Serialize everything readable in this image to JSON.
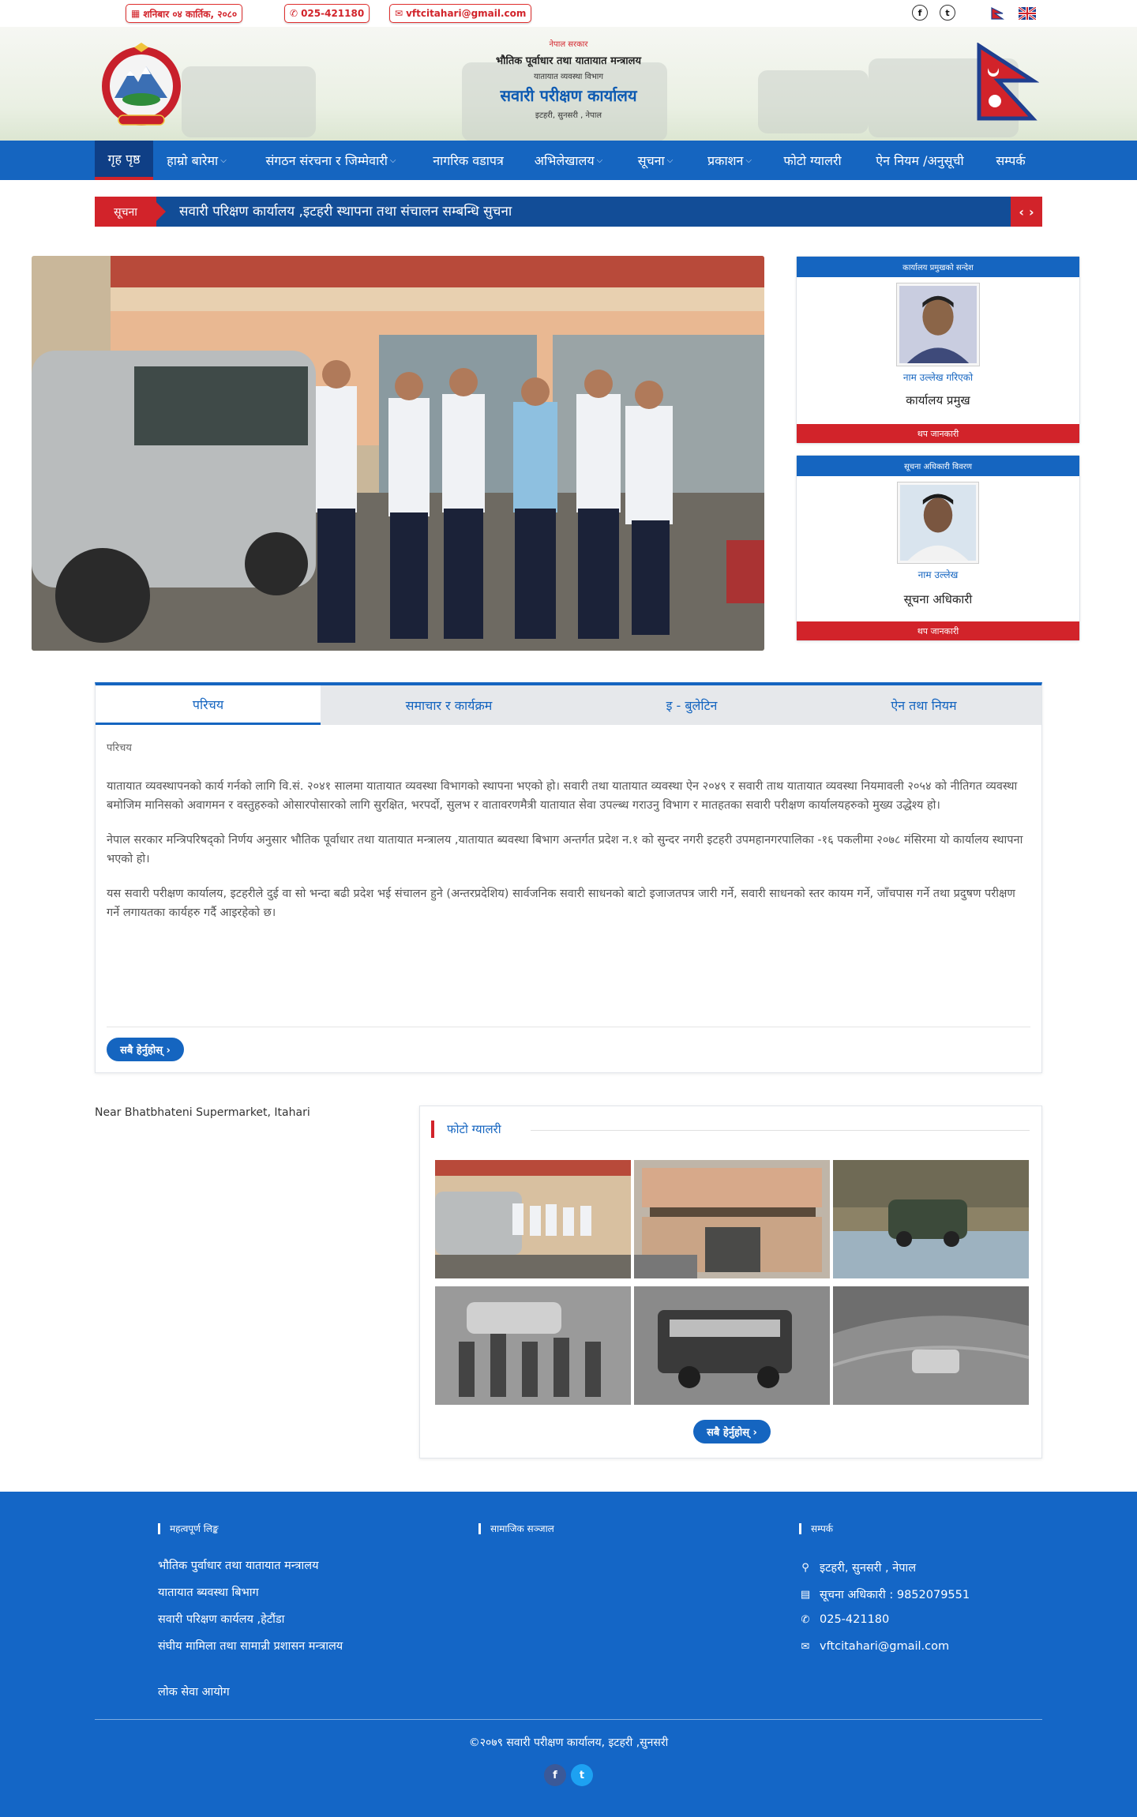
{
  "topbar": {
    "date": "शनिबार ०४ कार्तिक, २०८०",
    "phone": "025-421180",
    "email": "vftcitahari@gmail.com",
    "social": {
      "facebook": "f",
      "twitter": "t"
    }
  },
  "header": {
    "line1": "नेपाल सरकार",
    "line2": "भौतिक पूर्वाधार तथा यातायात मन्त्रालय",
    "line3": "यातायात व्यवस्था विभाग",
    "line4": "सवारी परीक्षण कार्यालय",
    "line5": "इटहरी, सुनसरी , नेपाल"
  },
  "nav": {
    "items": [
      {
        "label": "गृह पृष्ठ",
        "active": true
      },
      {
        "label": "हाम्रो बारेमा",
        "chevron": true
      },
      {
        "label": "संगठन संरचना र जिम्मेवारी",
        "chevron": true
      },
      {
        "label": "नागरिक वडापत्र"
      },
      {
        "label": "अभिलेखालय",
        "chevron": true
      },
      {
        "label": "सूचना",
        "chevron": true
      },
      {
        "label": "प्रकाशन",
        "chevron": true
      },
      {
        "label": "फोटो ग्यालरी"
      },
      {
        "label": "ऐन नियम /अनुसूची"
      },
      {
        "label": "सम्पर्क"
      }
    ]
  },
  "ticker": {
    "label": "सूचना",
    "text": "सवारी परिक्षण कार्यालय ,इटहरी स्थापना तथा संचालन सम्बन्धि सुचना",
    "prev": "‹",
    "next": "›"
  },
  "profiles": [
    {
      "heading": "कार्यालय प्रमुखको सन्देश",
      "name": "नाम उल्लेख गरिएको",
      "role": "कार्यालय प्रमुख",
      "button": "थप जानकारी"
    },
    {
      "heading": "सूचना अधिकारी विवरण",
      "name": "नाम उल्लेख",
      "role": "सूचना अधिकारी",
      "button": "थप जानकारी"
    }
  ],
  "tabs": {
    "items": [
      "परिचय",
      "समाचार र कार्यक्रम",
      "इ - बुलेटिन",
      "ऐन तथा नियम"
    ],
    "active_index": 0,
    "intro_sub": "परिचय",
    "paragraphs": [
      "यातायात व्यवस्थापनको कार्य गर्नको लागि वि.सं. २०४१ सालमा यातायात व्यवस्था विभागको स्थापना भएको हो। सवारी तथा यातायात व्यवस्था ऐन २०४९ र सवारी ताथ यातायात व्यवस्था नियमावली २०५४ को नीतिगत व्यवस्था बमोजिम मानिसको अवागमन र वस्तुहरुको ओसारपोसारको लागि सुरक्षित, भरपर्दो, सुलभ र वातावरणमैत्री यातायात सेवा उपल्ब्ध गराउनु विभाग र मातहतका सवारी परीक्षण कार्यालयहरुको मुख्य उद्धेश्य हो।",
      "नेपाल सरकार मन्त्रिपरिषद्को निर्णय अनुसार भौतिक पूर्वाधार तथा यातायात मन्त्रालय ,यातायात ब्यवस्था बिभाग अन्तर्गत प्रदेश न.१ को सुन्दर नगरी इटहरी उपमहानगरपालिका -१६ पकलीमा २०७८ मंसिरमा यो कार्यालय स्थापना भएको हो।",
      "यस सवारी परीक्षण कार्यालय, इटहरीले दुई वा सो भन्दा बढी प्रदेश भई संचालन हुने (अन्तरप्रदेशिय) सार्वजनिक सवारी साधनको बाटो इजाजतपत्र जारी गर्ने, सवारी साधनको स्तर कायम गर्ने, जाँचपास गर्ने तथा प्रदुषण परीक्षण गर्ने लगायतका कार्यहरु गर्दै  आइरहेको छ।"
    ],
    "view_all": "सबै हेर्नुहोस् ›"
  },
  "address": "Near Bhatbhateni Supermarket, Itahari",
  "gallery": {
    "title": "फोटो ग्यालरी",
    "view_all": "सबै हेर्नुहोस् ›"
  },
  "footer": {
    "col1_title": "महत्वपूर्ण लिङ्क",
    "col2_title": "सामाजिक सञ्जाल",
    "col3_title": "सम्पर्क",
    "links": [
      "भौतिक पुर्वाधार तथा यातायात मन्त्रालय",
      "यातायात ब्यवस्था बिभाग",
      "सवारी परिक्षण कार्यलय ,हेटौंडा",
      "संघीय मामिला तथा सामान्री प्रशासन मन्त्रालय",
      "लोक सेवा आयोग"
    ],
    "contact": {
      "address": "इटहरी, सुनसरी , नेपाल",
      "info_officer": "सूचना अधिकारी : 9852079551",
      "phone": "025-421180",
      "email": "vftcitahari@gmail.com"
    },
    "copyright": "©२०७९ सवारी परीक्षण कार्यालय, इटहरी ,सुनसरी",
    "social": {
      "facebook": "f",
      "twitter": "t"
    }
  },
  "colors": {
    "primary_blue": "#1565c0",
    "accent_red": "#d2232a",
    "footer_blue": "#1466c6"
  },
  "icons": [
    "calendar-icon",
    "phone-icon",
    "email-icon",
    "facebook-icon",
    "twitter-icon",
    "map-marker-icon",
    "id-card-icon"
  ]
}
